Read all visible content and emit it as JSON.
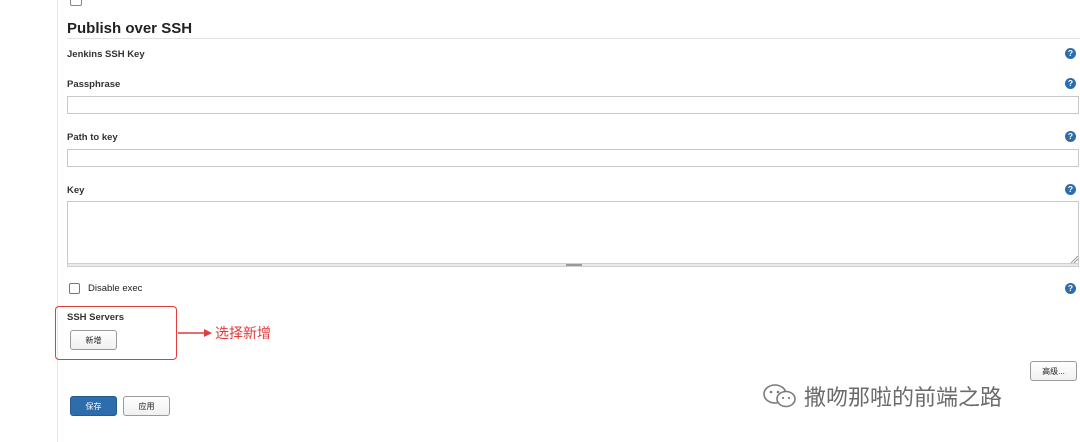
{
  "clipped_option_label": "",
  "publish_over_ssh": {
    "title": "Publish over SSH",
    "jenkins_ssh_key_label": "Jenkins SSH Key",
    "passphrase_label": "Passphrase",
    "passphrase_value": "",
    "path_to_key_label": "Path to key",
    "path_to_key_value": "",
    "key_label": "Key",
    "key_value": "",
    "disable_exec_label": "Disable exec",
    "disable_exec_checked": false,
    "ssh_servers_label": "SSH Servers",
    "add_button_label": "新增",
    "advanced_button_label": "高级...",
    "help_glyph": "?"
  },
  "annotation": {
    "text": "选择新增",
    "color": "#e23b3b"
  },
  "footer": {
    "save_label": "保存",
    "apply_label": "应用"
  },
  "watermark": {
    "text": "撒吻那啦的前端之路"
  },
  "colors": {
    "primary_button": "#2d6dab",
    "help_icon": "#2d6dab",
    "annotation_red": "#e23b3b"
  }
}
